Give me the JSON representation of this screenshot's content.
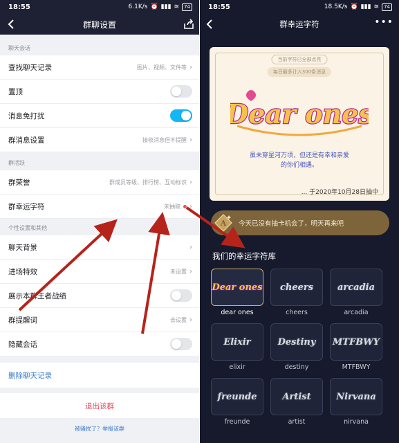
{
  "left": {
    "status": {
      "time": "18:55",
      "speed": "6.1K/s",
      "signal": "ᐩill ᐩill",
      "battery": "74"
    },
    "header": {
      "title": "群聊设置"
    },
    "sections": {
      "chat": "聊天会话",
      "active": "群活跃",
      "personal": "个性设置和其他"
    },
    "rows": {
      "history": {
        "label": "查找聊天记录",
        "value": "图片、视频、文件等"
      },
      "pin": {
        "label": "置顶",
        "on": false
      },
      "mute": {
        "label": "消息免打扰",
        "on": true
      },
      "msg_setting": {
        "label": "群消息设置",
        "value": "接收消息但不提醒"
      },
      "honor": {
        "label": "群荣誉",
        "value": "群成员等级、排行榜、互动标识"
      },
      "lucky": {
        "label": "群幸运字符",
        "value": "未抽取"
      },
      "background": {
        "label": "聊天背景"
      },
      "entrance": {
        "label": "进场特效",
        "value": "未设置"
      },
      "honor_king": {
        "label": "展示本群王者战绩",
        "on": false
      },
      "reminder": {
        "label": "群提醒词",
        "value": "去设置"
      },
      "hide": {
        "label": "隐藏会话",
        "on": false
      }
    },
    "delete_history": "删除聊天记录",
    "quit": "退出该群",
    "report": "被骚扰了？举报该群"
  },
  "right": {
    "status": {
      "time": "18:55",
      "speed": "18.5K/s",
      "battery": "74"
    },
    "header": {
      "title": "群幸运字符",
      "more": "•••"
    },
    "card": {
      "pill_top": "当前字符已全部点亮",
      "pill_sub": "每日最多计入300条消息",
      "logo_text": "Dear ones",
      "quote_line1": "虽未穿星河万顷，但还是有幸和亲爱",
      "quote_line2": "的你们相遇。",
      "date": "... 于2020年10月28日抽中"
    },
    "notice": "今天已没有抽卡机会了，明天再来吧",
    "library_title": "我们的幸运字符库",
    "tiles": [
      {
        "art": "Dear ones",
        "label": "dear ones",
        "selected": true
      },
      {
        "art": "cheers",
        "label": "cheers",
        "selected": false
      },
      {
        "art": "arcadia",
        "label": "arcadia",
        "selected": false
      },
      {
        "art": "Elixir",
        "label": "elixir",
        "selected": false
      },
      {
        "art": "Destiny",
        "label": "destiny",
        "selected": false
      },
      {
        "art": "MTFBWY",
        "label": "MTFBWY",
        "selected": false
      },
      {
        "art": "freunde",
        "label": "freunde",
        "selected": false
      },
      {
        "art": "Artist",
        "label": "artist",
        "selected": false
      },
      {
        "art": "Nirvana",
        "label": "nirvana",
        "selected": false
      }
    ]
  },
  "colors": {
    "dark_header": "#1e2133",
    "toggle_on": "#12b7f5",
    "quit_red": "#e8495c",
    "link_blue": "#3a78c9",
    "arrow_red": "#b5231b",
    "right_bg": "#161a2c",
    "gold": "#d6b277"
  }
}
